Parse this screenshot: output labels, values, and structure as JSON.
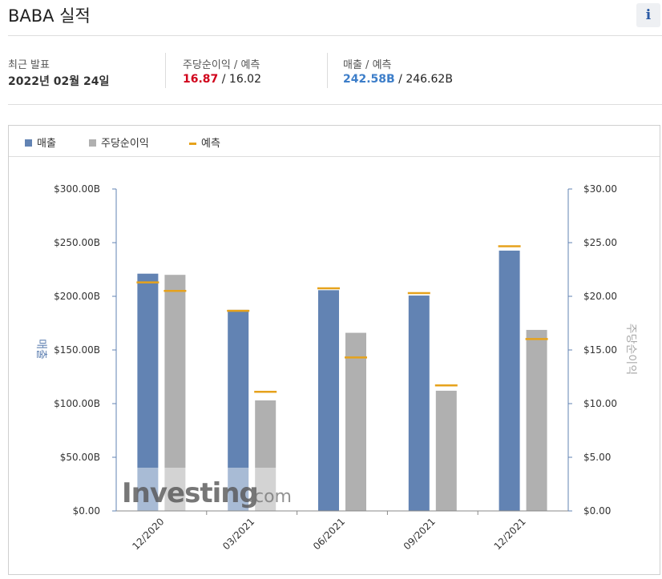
{
  "header": {
    "title": "BABA 실적",
    "info_icon_glyph": "i"
  },
  "stats": {
    "date_label": "최근 발표",
    "date_value": "2022년 02월 24일",
    "eps_label": "주당순이익 / 예측",
    "eps_actual": "16.87",
    "eps_forecast": "16.02",
    "rev_label": "매출 / 예측",
    "rev_actual": "242.58B",
    "rev_forecast": "246.62B",
    "slash": "/"
  },
  "legend": {
    "revenue": "매출",
    "eps": "주당순이익",
    "forecast": "예측"
  },
  "colors": {
    "revenue": "#6283b3",
    "eps": "#b0b0b0",
    "forecast": "#e6a21c",
    "eps_red": "#d0021b",
    "rev_blue": "#3d7ec9"
  },
  "watermark": {
    "text_bold": "Investing",
    "text_light": ".com"
  },
  "chart_data": {
    "type": "bar",
    "categories": [
      "12/2020",
      "03/2021",
      "06/2021",
      "09/2021",
      "12/2021"
    ],
    "left_axis": {
      "label": "매출",
      "ylim": [
        0,
        300
      ],
      "ticks": [
        "$0.00",
        "$50.00B",
        "$100.00B",
        "$150.00B",
        "$200.00B",
        "$250.00B",
        "$300.00B"
      ]
    },
    "right_axis": {
      "label": "주당순이익",
      "ylim": [
        0,
        30
      ],
      "ticks": [
        "$0.00",
        "$5.00",
        "$10.00",
        "$15.00",
        "$20.00",
        "$25.00",
        "$30.00"
      ]
    },
    "series": [
      {
        "name": "매출",
        "axis": "left",
        "values": [
          221.1,
          187.4,
          205.7,
          200.7,
          242.58
        ],
        "forecast": [
          213.0,
          186.5,
          207.5,
          203.0,
          246.62
        ]
      },
      {
        "name": "주당순이익",
        "axis": "right",
        "values": [
          22.0,
          10.3,
          16.6,
          11.2,
          16.87
        ],
        "forecast": [
          20.5,
          11.1,
          14.3,
          11.7,
          16.02
        ]
      }
    ],
    "grid": false,
    "legend_position": "top-left"
  }
}
